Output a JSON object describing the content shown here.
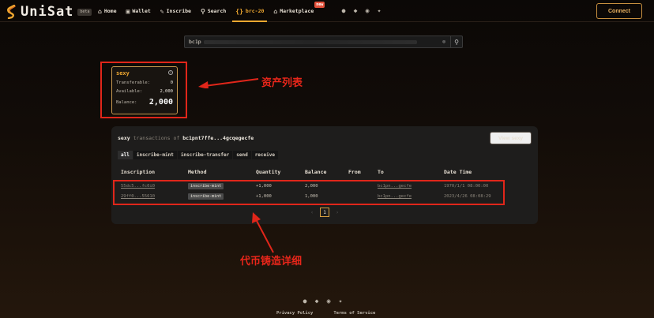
{
  "header": {
    "logo_text": "UniSat",
    "beta_label": "beta",
    "nav": [
      {
        "label": "Home",
        "icon": "home-icon"
      },
      {
        "label": "Wallet",
        "icon": "wallet-icon"
      },
      {
        "label": "Inscribe",
        "icon": "inscribe-icon"
      },
      {
        "label": "Search",
        "icon": "search-icon"
      },
      {
        "label": "brc-20",
        "icon": "brc20-icon",
        "active": true
      },
      {
        "label": "Marketplace",
        "icon": "marketplace-icon",
        "badge": "new"
      }
    ],
    "connect_label": "Connect"
  },
  "search": {
    "value": "bc1p"
  },
  "asset": {
    "ticker": "sexy",
    "transferable_label": "Transferable:",
    "transferable_value": "0",
    "available_label": "Available:",
    "available_value": "2,000",
    "balance_label": "Balance:",
    "balance_value": "2,000"
  },
  "annotations": {
    "asset_list": "资产列表",
    "mint_detail": "代币铸造详细"
  },
  "transactions": {
    "ticker": "sexy",
    "title_middle": " transactions of ",
    "address": "bc1pnt7ffe...4gcqegecfe",
    "view_button": "View sexy",
    "tabs": [
      "all",
      "inscribe-mint",
      "inscribe-transfer",
      "send",
      "receive"
    ],
    "columns": [
      "Inscription",
      "Method",
      "Quantity",
      "Balance",
      "From",
      "To",
      "Date Time"
    ],
    "rows": [
      {
        "inscription": "55dc5...fc0i0",
        "method": "inscribe-mint",
        "quantity": "+1,000",
        "balance": "2,000",
        "from": "",
        "to": "bc1pn...gecfe",
        "date": "1970/1/1 08:00:00"
      },
      {
        "inscription": "29ff0...55610",
        "method": "inscribe-mint",
        "quantity": "+1,000",
        "balance": "1,000",
        "from": "",
        "to": "bc1pn...gecfe",
        "date": "2023/4/26 08:08:29"
      }
    ],
    "page": "1"
  },
  "footer": {
    "privacy": "Privacy Policy",
    "terms": "Terms of Service"
  },
  "colors": {
    "accent": "#f0a830",
    "annotation_red": "#e0261a"
  }
}
